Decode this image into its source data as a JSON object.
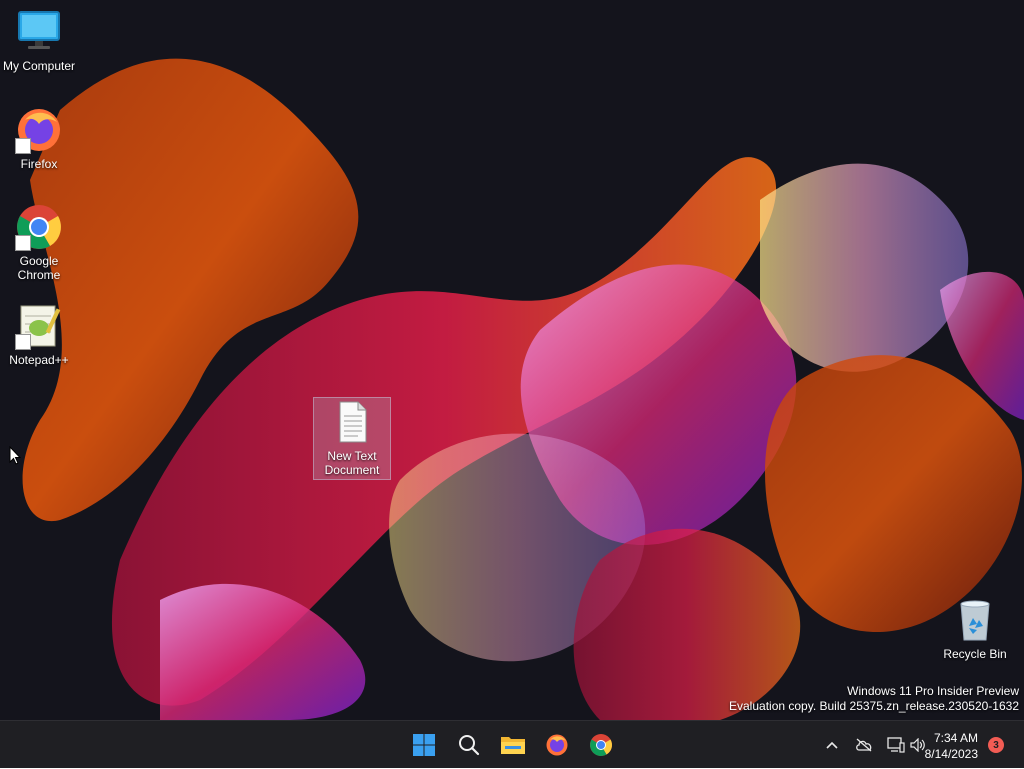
{
  "desktop": {
    "icons": [
      {
        "label": "My Computer",
        "icon": "monitor-icon"
      },
      {
        "label": "Firefox",
        "icon": "firefox-icon"
      },
      {
        "label": "Google Chrome",
        "icon": "chrome-icon"
      },
      {
        "label": "Notepad++",
        "icon": "notepadpp-icon"
      },
      {
        "label": "New Text Document",
        "icon": "text-document-icon"
      },
      {
        "label": "Recycle Bin",
        "icon": "recycle-bin-icon"
      }
    ],
    "watermark": {
      "line1": "Windows 11 Pro Insider Preview",
      "line2": "Evaluation copy. Build 25375.zn_release.230520-1632"
    }
  },
  "taskbar": {
    "pinned": [
      {
        "icon": "windows-start-icon"
      },
      {
        "icon": "search-icon"
      },
      {
        "icon": "file-explorer-icon"
      },
      {
        "icon": "firefox-icon"
      },
      {
        "icon": "chrome-icon"
      }
    ],
    "tray": {
      "icons": [
        "chevron-up-icon",
        "cloud-offline-icon",
        "network-icon",
        "volume-icon"
      ],
      "time": "7:34 AM",
      "date": "8/14/2023",
      "notification_count": "3"
    }
  },
  "colors": {
    "taskbar_bg": "#1f1f23",
    "desktop_bg": "#14141c",
    "notification_badge": "#f25c54",
    "windows_blue": "#3aa0f0"
  }
}
